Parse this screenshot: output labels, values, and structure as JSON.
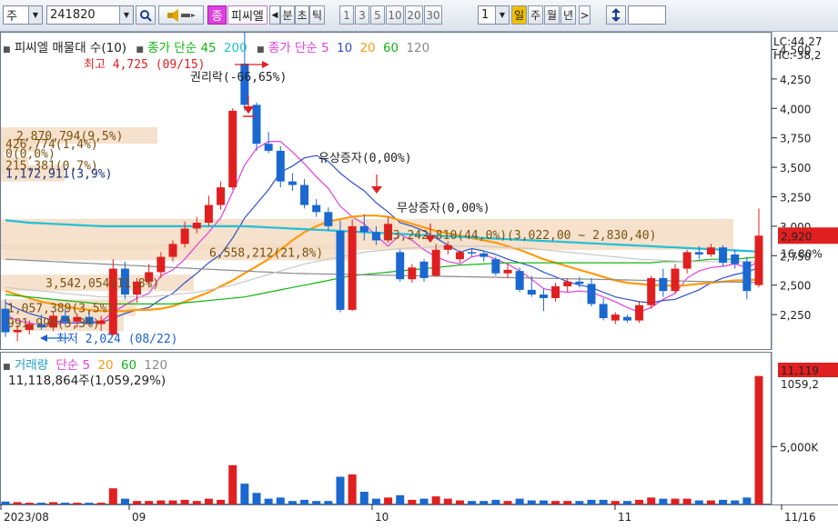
{
  "toolbar": {
    "market_label": "주",
    "code_value": "241820",
    "type_badge": "종",
    "stock_name": "피씨엘",
    "tab_minute": "분",
    "tab_second": "초",
    "tab_tick": "틱",
    "intervals": [
      "1",
      "3",
      "5",
      "10",
      "20",
      "30"
    ],
    "interval_value": "1",
    "period_day": "일",
    "period_week": "주",
    "period_month": "월",
    "period_year": "년",
    "next_label": ">",
    "colors": {
      "accent": "#e040e0",
      "active_day": "#f0c000"
    }
  },
  "price_legend": {
    "title": "피씨엘 매물대 수(10)",
    "ma1_label": "종가 단순",
    "ma1_periods": [
      "45",
      "200"
    ],
    "ma2_label": "종가 단순",
    "ma2_periods": [
      "5",
      "10",
      "20",
      "60",
      "120"
    ],
    "lc_label": "LC:44,27",
    "hc_label": "HC:-38,2"
  },
  "volume_legend": {
    "title": "거래량",
    "ma_label": "단순",
    "periods": [
      "5",
      "20",
      "60",
      "120"
    ],
    "last_value": "11,118,864주(1,059,29%)"
  },
  "annotations": {
    "high": "최고 4,725 (09/15)",
    "low": "최저 2,024 (08/22)",
    "rights_ex": "권리락(-66,65%)",
    "rights_issue": "유상증자(0,00%)",
    "bonus_issue": "무상증자(0,00%)"
  },
  "volume_profile": [
    "2,870,794(9,5%)",
    "426,774(1,4%)",
    "0(0,0%)",
    "215,381(0,7%)",
    "1,172,911(3,9%)",
    "13,242,810(44,0%)(3,022,00 ~ 2,830,40)",
    "6,558,212(21,8%)",
    "3,542,054(11,8%)",
    "1,057,389(3,5%)",
    "991,999(3,3%)"
  ],
  "price_axis": [
    "4,500",
    "4,250",
    "4,000",
    "3,750",
    "3,500",
    "3,250",
    "3,000",
    "2,750",
    "2,500",
    "2,250"
  ],
  "price_tags": {
    "current": "2,920",
    "change": "16,80%"
  },
  "volume_axis": {
    "mid": "5,000K",
    "tag_value": "11,119",
    "tag_pct": "1059,2"
  },
  "date_axis": [
    "2023/08",
    "09",
    "10",
    "11",
    "11/16"
  ],
  "chart_data": {
    "type": "candlestick",
    "y_range": [
      1950,
      4650
    ],
    "candles": [
      {
        "o": 2300,
        "h": 2380,
        "l": 2060,
        "c": 2100,
        "v": 0.25
      },
      {
        "o": 2100,
        "h": 2160,
        "l": 2024,
        "c": 2120,
        "v": 0.2
      },
      {
        "o": 2120,
        "h": 2200,
        "l": 2080,
        "c": 2170,
        "v": 0.15
      },
      {
        "o": 2170,
        "h": 2250,
        "l": 2120,
        "c": 2140,
        "v": 0.15
      },
      {
        "o": 2140,
        "h": 2270,
        "l": 2110,
        "c": 2240,
        "v": 0.2
      },
      {
        "o": 2240,
        "h": 2300,
        "l": 2160,
        "c": 2190,
        "v": 0.15
      },
      {
        "o": 2190,
        "h": 2260,
        "l": 2140,
        "c": 2230,
        "v": 0.15
      },
      {
        "o": 2230,
        "h": 2290,
        "l": 2150,
        "c": 2170,
        "v": 0.15
      },
      {
        "o": 2170,
        "h": 2240,
        "l": 2110,
        "c": 2200,
        "v": 0.15
      },
      {
        "o": 2080,
        "h": 2720,
        "l": 2070,
        "c": 2640,
        "v": 1.4
      },
      {
        "o": 2640,
        "h": 2700,
        "l": 2380,
        "c": 2420,
        "v": 0.5
      },
      {
        "o": 2420,
        "h": 2560,
        "l": 2350,
        "c": 2530,
        "v": 0.3
      },
      {
        "o": 2530,
        "h": 2680,
        "l": 2480,
        "c": 2610,
        "v": 0.3
      },
      {
        "o": 2610,
        "h": 2780,
        "l": 2560,
        "c": 2740,
        "v": 0.35
      },
      {
        "o": 2740,
        "h": 2880,
        "l": 2700,
        "c": 2850,
        "v": 0.35
      },
      {
        "o": 2850,
        "h": 3040,
        "l": 2820,
        "c": 2980,
        "v": 0.4
      },
      {
        "o": 2980,
        "h": 3080,
        "l": 2940,
        "c": 3030,
        "v": 0.3
      },
      {
        "o": 3030,
        "h": 3260,
        "l": 3000,
        "c": 3180,
        "v": 0.5
      },
      {
        "o": 3180,
        "h": 3380,
        "l": 3140,
        "c": 3330,
        "v": 0.4
      },
      {
        "o": 3330,
        "h": 4000,
        "l": 3310,
        "c": 3980,
        "v": 3.4
      },
      {
        "o": 4380,
        "h": 4725,
        "l": 3980,
        "c": 4030,
        "v": 1.8
      },
      {
        "o": 4030,
        "h": 4050,
        "l": 3640,
        "c": 3700,
        "v": 1.0
      },
      {
        "o": 3700,
        "h": 3800,
        "l": 3620,
        "c": 3640,
        "v": 0.5
      },
      {
        "o": 3640,
        "h": 3680,
        "l": 3330,
        "c": 3380,
        "v": 0.6
      },
      {
        "o": 3380,
        "h": 3450,
        "l": 3300,
        "c": 3350,
        "v": 0.3
      },
      {
        "o": 3350,
        "h": 3400,
        "l": 3150,
        "c": 3180,
        "v": 0.4
      },
      {
        "o": 3180,
        "h": 3230,
        "l": 3080,
        "c": 3120,
        "v": 0.3
      },
      {
        "o": 3120,
        "h": 3160,
        "l": 2960,
        "c": 3000,
        "v": 0.3
      },
      {
        "o": 2960,
        "h": 3050,
        "l": 2270,
        "c": 2290,
        "v": 2.4
      },
      {
        "o": 2290,
        "h": 3060,
        "l": 2280,
        "c": 3000,
        "v": 2.6
      },
      {
        "o": 3000,
        "h": 3100,
        "l": 2880,
        "c": 2950,
        "v": 1.1
      },
      {
        "o": 2950,
        "h": 3000,
        "l": 2840,
        "c": 2880,
        "v": 0.5
      },
      {
        "o": 2880,
        "h": 3080,
        "l": 2860,
        "c": 3020,
        "v": 0.6
      },
      {
        "o": 2780,
        "h": 2800,
        "l": 2530,
        "c": 2550,
        "v": 0.8
      },
      {
        "o": 2550,
        "h": 2680,
        "l": 2520,
        "c": 2650,
        "v": 0.4
      },
      {
        "o": 2700,
        "h": 2720,
        "l": 2530,
        "c": 2560,
        "v": 0.5
      },
      {
        "o": 2580,
        "h": 2850,
        "l": 2570,
        "c": 2800,
        "v": 0.7
      },
      {
        "o": 2800,
        "h": 2870,
        "l": 2760,
        "c": 2840,
        "v": 0.5
      },
      {
        "o": 2720,
        "h": 2800,
        "l": 2690,
        "c": 2780,
        "v": 0.35
      },
      {
        "o": 2780,
        "h": 2810,
        "l": 2740,
        "c": 2770,
        "v": 0.3
      },
      {
        "o": 2770,
        "h": 2790,
        "l": 2700,
        "c": 2740,
        "v": 0.3
      },
      {
        "o": 2720,
        "h": 2740,
        "l": 2580,
        "c": 2600,
        "v": 0.4
      },
      {
        "o": 2600,
        "h": 2680,
        "l": 2560,
        "c": 2630,
        "v": 0.3
      },
      {
        "o": 2620,
        "h": 2650,
        "l": 2440,
        "c": 2460,
        "v": 0.5
      },
      {
        "o": 2460,
        "h": 2580,
        "l": 2400,
        "c": 2420,
        "v": 0.35
      },
      {
        "o": 2420,
        "h": 2470,
        "l": 2280,
        "c": 2390,
        "v": 0.35
      },
      {
        "o": 2390,
        "h": 2520,
        "l": 2360,
        "c": 2490,
        "v": 0.3
      },
      {
        "o": 2490,
        "h": 2560,
        "l": 2440,
        "c": 2530,
        "v": 0.3
      },
      {
        "o": 2530,
        "h": 2570,
        "l": 2480,
        "c": 2510,
        "v": 0.3
      },
      {
        "o": 2510,
        "h": 2560,
        "l": 2320,
        "c": 2340,
        "v": 0.4
      },
      {
        "o": 2340,
        "h": 2390,
        "l": 2200,
        "c": 2220,
        "v": 0.4
      },
      {
        "o": 2200,
        "h": 2270,
        "l": 2170,
        "c": 2250,
        "v": 0.3
      },
      {
        "o": 2230,
        "h": 2250,
        "l": 2180,
        "c": 2200,
        "v": 0.3
      },
      {
        "o": 2200,
        "h": 2360,
        "l": 2180,
        "c": 2330,
        "v": 0.4
      },
      {
        "o": 2330,
        "h": 2580,
        "l": 2300,
        "c": 2560,
        "v": 0.6
      },
      {
        "o": 2560,
        "h": 2640,
        "l": 2400,
        "c": 2450,
        "v": 0.5
      },
      {
        "o": 2450,
        "h": 2680,
        "l": 2430,
        "c": 2640,
        "v": 0.5
      },
      {
        "o": 2640,
        "h": 2800,
        "l": 2600,
        "c": 2780,
        "v": 0.5
      },
      {
        "o": 2780,
        "h": 2830,
        "l": 2720,
        "c": 2760,
        "v": 0.35
      },
      {
        "o": 2760,
        "h": 2850,
        "l": 2740,
        "c": 2820,
        "v": 0.35
      },
      {
        "o": 2820,
        "h": 2840,
        "l": 2660,
        "c": 2690,
        "v": 0.4
      },
      {
        "o": 2760,
        "h": 2800,
        "l": 2640,
        "c": 2680,
        "v": 0.35
      },
      {
        "o": 2700,
        "h": 2740,
        "l": 2380,
        "c": 2450,
        "v": 0.6
      },
      {
        "o": 2500,
        "h": 3150,
        "l": 2480,
        "c": 2920,
        "v": 11.118864
      }
    ],
    "ma_lines": [
      {
        "name": "5",
        "color": "#e040e0",
        "values": [
          2250,
          2200,
          2180,
          2160,
          2170,
          2180,
          2180,
          2190,
          2190,
          2270,
          2330,
          2390,
          2430,
          2580,
          2630,
          2720,
          2840,
          2950,
          3070,
          3290,
          3520,
          3660,
          3720,
          3720,
          3630,
          3530,
          3420,
          3320,
          3170,
          3080,
          3020,
          2920,
          2830,
          2930,
          2880,
          2800,
          2740,
          2700,
          2680,
          2740,
          2760,
          2720,
          2680,
          2620,
          2550,
          2470,
          2450,
          2440,
          2450,
          2440,
          2400,
          2360,
          2310,
          2270,
          2310,
          2380,
          2430,
          2560,
          2620,
          2650,
          2660,
          2680,
          2650,
          2700
        ]
      },
      {
        "name": "10",
        "color": "#3050c8",
        "values": [
          2350,
          2300,
          2260,
          2230,
          2200,
          2180,
          2180,
          2180,
          2180,
          2220,
          2260,
          2290,
          2310,
          2380,
          2430,
          2520,
          2600,
          2690,
          2760,
          2900,
          3070,
          3190,
          3310,
          3460,
          3510,
          3580,
          3600,
          3550,
          3450,
          3370,
          3300,
          3200,
          3120,
          3030,
          3000,
          2960,
          2900,
          2840,
          2780,
          2810,
          2790,
          2760,
          2720,
          2690,
          2660,
          2610,
          2570,
          2530,
          2500,
          2480,
          2440,
          2400,
          2380,
          2360,
          2350,
          2370,
          2380,
          2420,
          2460,
          2520,
          2560,
          2590,
          2610,
          2650
        ]
      },
      {
        "name": "20",
        "color": "#ff9a10",
        "values": [
          2450,
          2420,
          2390,
          2360,
          2340,
          2320,
          2300,
          2290,
          2280,
          2280,
          2280,
          2290,
          2290,
          2300,
          2320,
          2360,
          2400,
          2440,
          2490,
          2540,
          2600,
          2660,
          2720,
          2800,
          2880,
          2950,
          3000,
          3040,
          3060,
          3080,
          3090,
          3090,
          3080,
          3050,
          3020,
          2990,
          2960,
          2940,
          2920,
          2900,
          2880,
          2860,
          2830,
          2800,
          2760,
          2720,
          2690,
          2660,
          2630,
          2600,
          2570,
          2540,
          2520,
          2510,
          2500,
          2500,
          2490,
          2500,
          2510,
          2520,
          2530,
          2540,
          2540,
          2550
        ]
      },
      {
        "name": "60",
        "color": "#14b414",
        "values": [
          2420,
          2410,
          2400,
          2390,
          2380,
          2370,
          2360,
          2350,
          2340,
          2340,
          2340,
          2340,
          2340,
          2340,
          2340,
          2350,
          2360,
          2370,
          2380,
          2390,
          2400,
          2420,
          2440,
          2460,
          2480,
          2500,
          2520,
          2540,
          2560,
          2580,
          2590,
          2600,
          2610,
          2620,
          2630,
          2640,
          2650,
          2660,
          2670,
          2675,
          2680,
          2685,
          2690,
          2690,
          2690,
          2690,
          2690,
          2690,
          2690,
          2690,
          2690,
          2690,
          2690,
          2690,
          2690,
          2700,
          2700,
          2700,
          2710,
          2720,
          2720,
          2720,
          2730,
          2740
        ]
      },
      {
        "name": "120",
        "color": "#8a8a8a",
        "values": [
          2720,
          2715,
          2710,
          2705,
          2700,
          2695,
          2690,
          2685,
          2680,
          2675,
          2670,
          2665,
          2660,
          2655,
          2650,
          2645,
          2640,
          2635,
          2630,
          2625,
          2620,
          2615,
          2610,
          2605,
          2600,
          2598,
          2596,
          2594,
          2592,
          2590,
          2588,
          2586,
          2584,
          2582,
          2580,
          2578,
          2576,
          2574,
          2572,
          2570,
          2568,
          2566,
          2564,
          2562,
          2560,
          2558,
          2556,
          2554,
          2552,
          2550,
          2548,
          2546,
          2544,
          2542,
          2540,
          2538,
          2536,
          2534,
          2532,
          2530,
          2528,
          2526,
          2524,
          2522
        ]
      },
      {
        "name": "45",
        "color": "#c8c8c8",
        "values": [
          2480,
          2470,
          2460,
          2450,
          2440,
          2430,
          2420,
          2410,
          2400,
          2400,
          2400,
          2400,
          2400,
          2410,
          2420,
          2430,
          2440,
          2460,
          2480,
          2500,
          2530,
          2560,
          2590,
          2620,
          2650,
          2680,
          2700,
          2720,
          2740,
          2760,
          2780,
          2790,
          2800,
          2810,
          2815,
          2820,
          2825,
          2830,
          2830,
          2830,
          2830,
          2825,
          2820,
          2815,
          2810,
          2800,
          2790,
          2780,
          2770,
          2760,
          2750,
          2740,
          2730,
          2720,
          2715,
          2710,
          2705,
          2700,
          2700,
          2700,
          2700,
          2700,
          2700,
          2700
        ]
      },
      {
        "name": "200",
        "color": "#20c0d8",
        "values": [
          3050,
          3040,
          3030,
          3025,
          3020,
          3015,
          3010,
          3005,
          3000,
          3000,
          3000,
          3000,
          3000,
          3000,
          3000,
          3000,
          3000,
          3000,
          3000,
          3000,
          3000,
          2995,
          2990,
          2985,
          2980,
          2975,
          2970,
          2965,
          2960,
          2955,
          2950,
          2945,
          2940,
          2935,
          2930,
          2925,
          2920,
          2915,
          2910,
          2905,
          2900,
          2895,
          2890,
          2885,
          2880,
          2875,
          2870,
          2865,
          2860,
          2855,
          2850,
          2845,
          2840,
          2835,
          2830,
          2825,
          2820,
          2815,
          2810,
          2805,
          2800,
          2795,
          2790,
          2785
        ]
      }
    ]
  }
}
